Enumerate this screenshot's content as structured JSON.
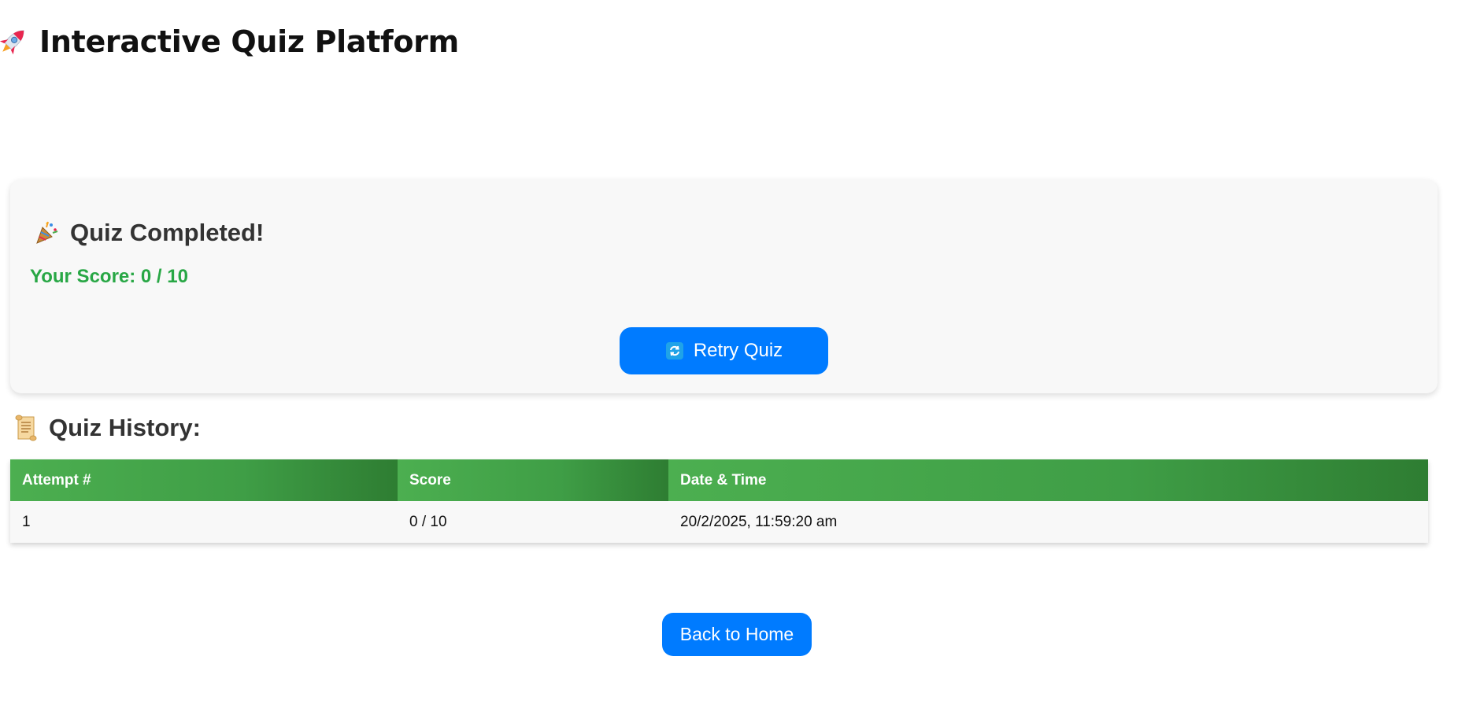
{
  "header": {
    "icon": "rocket-icon",
    "title": "Interactive Quiz Platform"
  },
  "result": {
    "icon": "party-popper-icon",
    "title": "Quiz Completed!",
    "score_text": "Your Score: 0 / 10",
    "retry_icon": "refresh-icon",
    "retry_label": "Retry Quiz"
  },
  "history": {
    "icon": "scroll-icon",
    "title": "Quiz History:",
    "columns": [
      "Attempt #",
      "Score",
      "Date & Time"
    ],
    "rows": [
      [
        "1",
        "0 / 10",
        "20/2/2025, 11:59:20 am"
      ]
    ]
  },
  "footer": {
    "home_label": "Back to Home"
  },
  "colors": {
    "primary_button": "#007bff",
    "score_green": "#28a745",
    "table_header_green": "#4caf50",
    "card_background": "#f8f8f8"
  }
}
